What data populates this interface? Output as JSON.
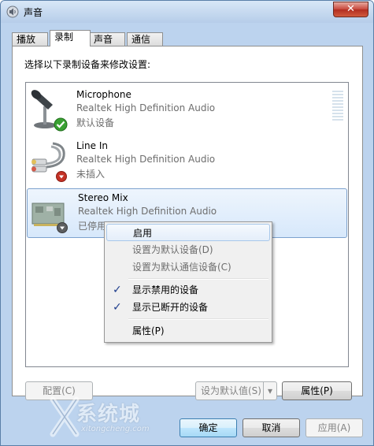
{
  "window": {
    "title": "声音",
    "close_label": "✕"
  },
  "tabs": [
    {
      "label": "播放"
    },
    {
      "label": "录制",
      "active": true
    },
    {
      "label": "声音"
    },
    {
      "label": "通信"
    }
  ],
  "instruction": "选择以下录制设备来修改设置:",
  "devices": [
    {
      "name": "Microphone",
      "driver": "Realtek High Definition Audio",
      "status": "默认设备",
      "icon": "microphone-icon",
      "badge": "green-check-icon"
    },
    {
      "name": "Line In",
      "driver": "Realtek High Definition Audio",
      "status": "未插入",
      "icon": "line-in-cable-icon",
      "badge": "red-down-arrow-icon"
    },
    {
      "name": "Stereo Mix",
      "driver": "Realtek High Definition Audio",
      "status": "已停用",
      "icon": "sound-card-icon",
      "badge": "gray-down-arrow-icon",
      "selected": true
    }
  ],
  "context_menu": {
    "items": [
      {
        "label": "启用",
        "disabled": false,
        "highlighted": true
      },
      {
        "label": "设置为默认设备(D)",
        "disabled": true
      },
      {
        "label": "设置为默认通信设备(C)",
        "disabled": true
      },
      {
        "label": "显示禁用的设备",
        "checked": true
      },
      {
        "label": "显示已断开的设备",
        "checked": true
      },
      {
        "label": "属性(P)"
      }
    ]
  },
  "buttons": {
    "configure": "配置(C)",
    "set_default": "设为默认值(S)",
    "properties": "属性(P)",
    "ok": "确定",
    "cancel": "取消",
    "apply": "应用(A)"
  },
  "watermark": {
    "text": "系统城",
    "url": "xitongcheng.com"
  },
  "colors": {
    "accent": "#3c7fb1",
    "close": "#c7463a",
    "check": "#1f3e8d"
  }
}
